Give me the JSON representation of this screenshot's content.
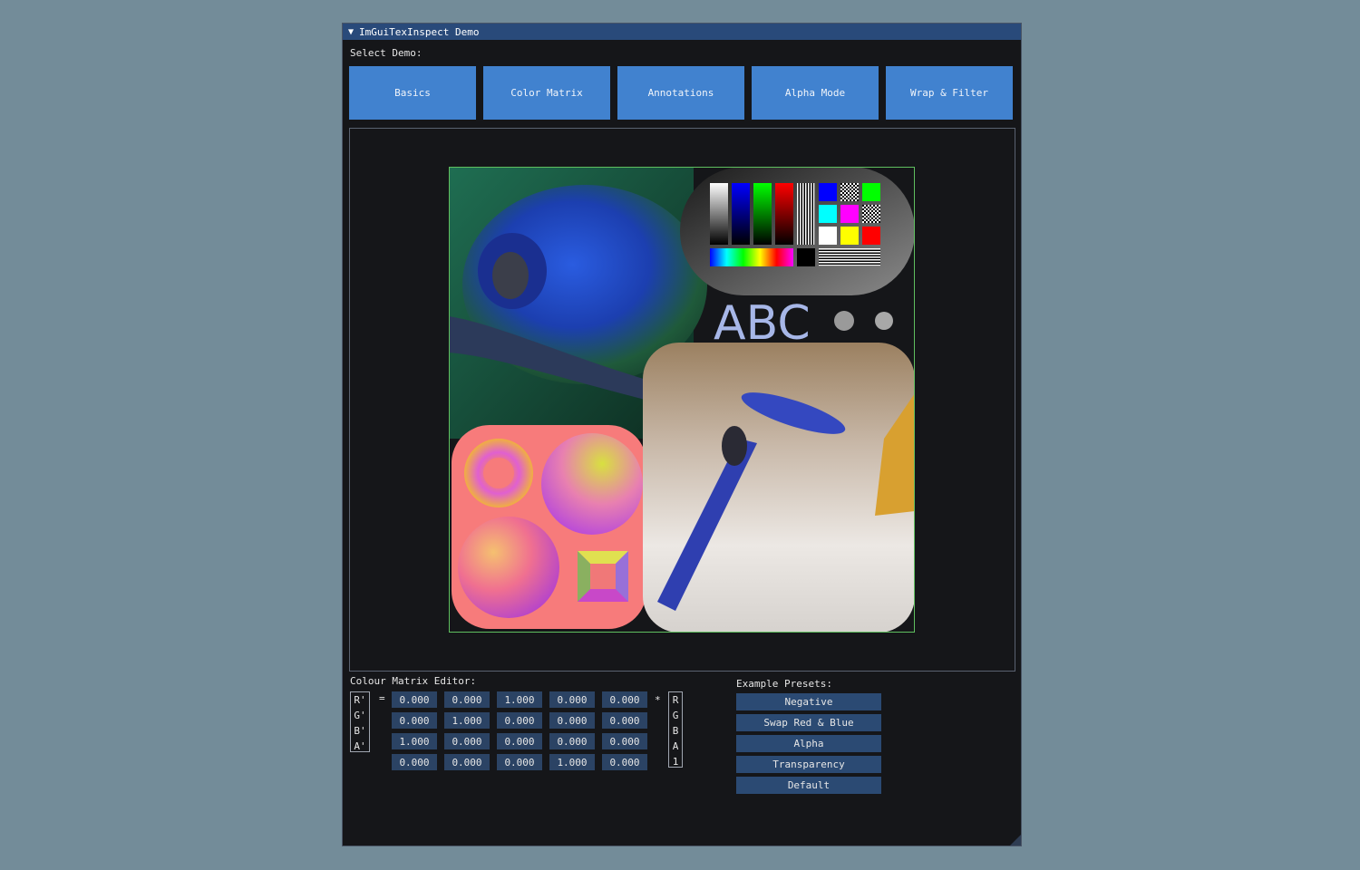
{
  "window": {
    "title": "ImGuiTexInspect Demo"
  },
  "select_demo_label": "Select Demo:",
  "demo_buttons": [
    "Basics",
    "Color Matrix",
    "Annotations",
    "Alpha Mode",
    "Wrap & Filter"
  ],
  "texture": {
    "text": "ABC"
  },
  "matrix_editor": {
    "title": "Colour Matrix Editor:",
    "output_labels": [
      "R'",
      "G'",
      "B'",
      "A'"
    ],
    "equals": "=",
    "times": "*",
    "input_labels": [
      "R",
      "G",
      "B",
      "A",
      "1"
    ],
    "rows": [
      [
        "0.000",
        "0.000",
        "1.000",
        "0.000",
        "0.000"
      ],
      [
        "0.000",
        "1.000",
        "0.000",
        "0.000",
        "0.000"
      ],
      [
        "1.000",
        "0.000",
        "0.000",
        "0.000",
        "0.000"
      ],
      [
        "0.000",
        "0.000",
        "0.000",
        "1.000",
        "0.000"
      ]
    ]
  },
  "presets": {
    "title": "Example Presets:",
    "buttons": [
      "Negative",
      "Swap Red & Blue",
      "Alpha",
      "Transparency",
      "Default"
    ]
  },
  "colors": {
    "background": "#738c99",
    "window_bg": "#151619",
    "titlebar": "#294a7a",
    "button": "#4182cf",
    "field": "#2b4364"
  }
}
